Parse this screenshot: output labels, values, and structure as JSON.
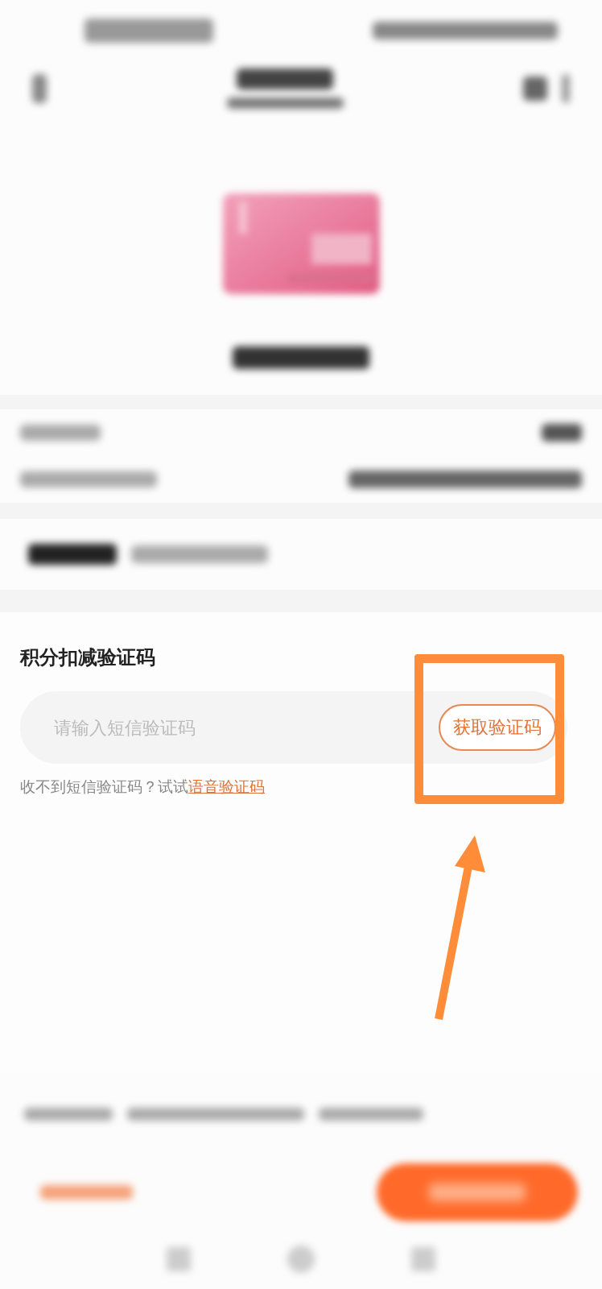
{
  "sheet": {
    "title": "积分扣减验证码",
    "code_field": {
      "placeholder": "请输入短信验证码"
    },
    "get_code_button": "获取验证码",
    "hint": "收不到短信验证码？试试",
    "hint_link": "语音验证码"
  },
  "annotations": [
    {
      "kind": "highlight-box"
    },
    {
      "kind": "arrow"
    }
  ]
}
